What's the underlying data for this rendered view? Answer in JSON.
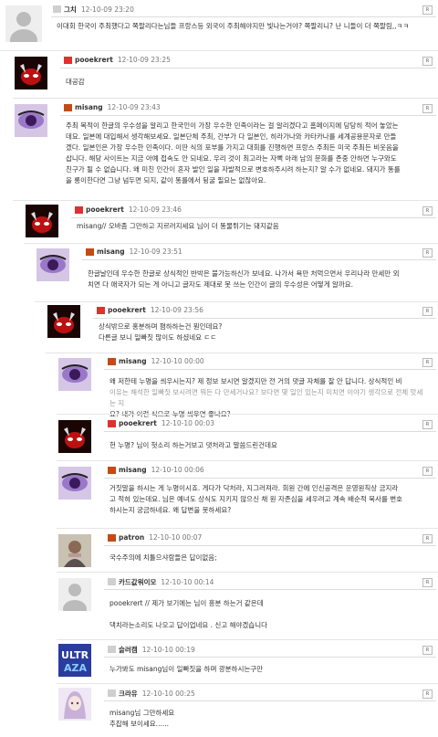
{
  "comments": [
    {
      "name": "그치",
      "date": "12-10-09 23:20",
      "lines": [
        "이대회 한국이 주최했다고 쪽팔리다는님들 프랑스등 외국이 주최해야지만 빛나는거야? 쪽팔리니? 난 니들이 더 쪽팔림,,ㅋㅋ"
      ]
    },
    {
      "name": "pooekrert",
      "date": "12-10-09 23:25",
      "lines": [
        "대공감"
      ]
    },
    {
      "name": "misang",
      "date": "12-10-09 23:43",
      "lines": [
        "주최 목적이 한글의 우수성을 알리고 한국인이 가장 우수한 민족이라는 걸 알리겠다고 홈페이지에 당당히 적어 놓았는",
        "데요. 일본에 대입해서 생각해보세요. 일본단체 주최, 간부가 다 일본인, 히라가나와 카타카나를 세계공용문자로 만들",
        "겠다. 일본인은 가장 우수한 민족이다. 이딴 식의 포부를 가지고 대회를 진행하면 프랑스 주최든 미국 주최든 비웃음을",
        "삽니다. 해당 사이트는 지금 아예 접속도 안 되네요. 우리 것이 최고라는 자뻑 아래 남의 문화를 존중 안하면 누구와도",
        "친구가 될 수 없습니다. 왜 미친 인간이 혼자 발인 일을 자발적으로 변호하주시려 하는지? 알 수가 없네요. 돼지가 똥를",
        "을 롱이한다면 그냥 넘두면 되지, 같이 똥를에서 뒹굴 필요는 없잖아요."
      ]
    },
    {
      "name": "pooekrert",
      "date": "12-10-09 23:46",
      "lines": [
        "misang// 오바좀 그만하고 지르러지세요 님이 더 똥물튀기는 돼지같음"
      ]
    },
    {
      "name": "misang",
      "date": "12-10-09 23:51",
      "lines": [
        "한글날인데 우수한 한글로 상식적인 반박은 불가능하신가 보네요. 나가서 욕만 처먹으면서 우리나라 만세만 외",
        "치면 다 애국자가 되는 게 아니고 글자도 제대로 못 쓰는 인간이 글의 우수성은 어떻게 알까요."
      ]
    },
    {
      "name": "pooekrert",
      "date": "12-10-09 23:56",
      "lines": [
        "상식밖으로 홍분하며 폄하하는건 뭔인데요?",
        "다른글 보니 일빠짓 많이도 하셨네요 ㄷㄷ"
      ]
    },
    {
      "name": "misang",
      "date": "12-10-10 00:00",
      "lines": [
        "왜 저한테 누명을 씌우시는지? 제 정보 보시면 알겠지만 전 거의 댓글 자체를 잘 안 답니다. 상식적인 비",
        "이유는 해석한 일빠짓 보시려면 뭐든 다 만세거나요? 보다면 몇 일인 있는지 미치면 이야기 생각으로 전체 맛세 는 지",
        "요? 내가 이런 식으로 누명 씌우면 좋나요?"
      ]
    },
    {
      "name": "pooekrert",
      "date": "12-10-10 00:03",
      "lines": [
        "헌 누명? 님이 헛소리 하는거보고 댓처라고 말씀드린건데요"
      ]
    },
    {
      "name": "misang",
      "date": "12-10-10 00:06",
      "lines": [
        "거짓말을 하시는 게 누명이시죠. 게다가 닥처라, 지그러져라. 회원 간에 인신공격은 운영원칙상 금지라",
        "고 적혀 있는데요. 님은 예녀도 상식도 지키지 않으신 채 원 자존심을 세우려고 계속 배순적 묵사를 변호",
        "하시는지 궁금하네요. 왜 답변을 못하세요?"
      ]
    },
    {
      "name": "patron",
      "date": "12-10-10 00:07",
      "lines": [
        "국수주의에 치틀으샤람들은 답이없음;"
      ]
    },
    {
      "name": "카드값워이모",
      "date": "12-10-10 00:14",
      "lines": [
        "pooekrert // 제가 보기에는 님이 흥분 하는거 같은데",
        "",
        "댁치라는소리도 나오고 답이업네요 . 신고 해야겠습니다"
      ]
    },
    {
      "name": "슬러캠",
      "date": "12-10-10 00:19",
      "lines": [
        "누가봐도 misang님이 일빠짓을 하며 광분하시는구만"
      ]
    },
    {
      "name": "크라유",
      "date": "12-10-10 00:25",
      "lines": [
        "misang님 그만하세요",
        "추잡해 보이세요......"
      ]
    }
  ]
}
